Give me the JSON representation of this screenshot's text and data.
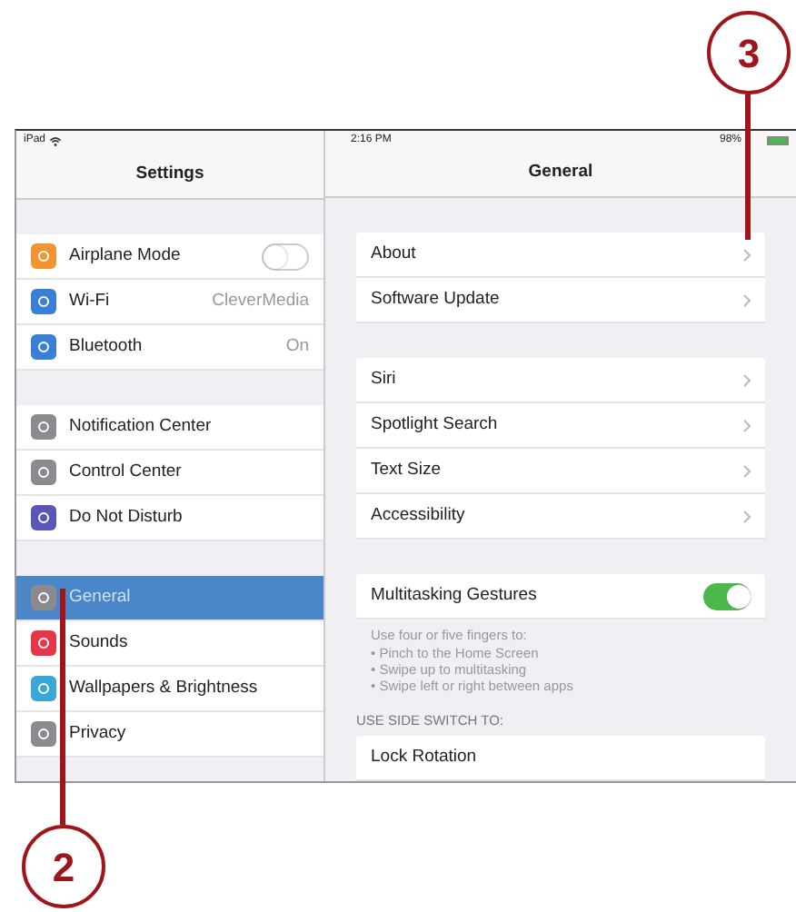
{
  "status_bar": {
    "device": "iPad",
    "time": "2:16 PM",
    "battery": "98%"
  },
  "sidebar": {
    "title": "Settings",
    "groups": [
      {
        "items": [
          {
            "label": "Airplane Mode",
            "color": "#f0952f",
            "kind": "toggle",
            "on": false,
            "selected": false
          },
          {
            "label": "Wi-Fi",
            "color": "#3a7fd6",
            "kind": "value",
            "value": "CleverMedia",
            "selected": false
          },
          {
            "label": "Bluetooth",
            "color": "#3a7fd6",
            "kind": "value",
            "value": "On",
            "selected": false
          }
        ]
      },
      {
        "items": [
          {
            "label": "Notification Center",
            "color": "#8a8a8f",
            "kind": "plain",
            "selected": false
          },
          {
            "label": "Control Center",
            "color": "#8a8a8f",
            "kind": "plain",
            "selected": false
          },
          {
            "label": "Do Not Disturb",
            "color": "#5a55b8",
            "kind": "plain",
            "selected": false
          }
        ]
      },
      {
        "items": [
          {
            "label": "General",
            "color": "#8a8a8f",
            "kind": "plain",
            "selected": true
          },
          {
            "label": "Sounds",
            "color": "#e8354a",
            "kind": "plain",
            "selected": false
          },
          {
            "label": "Wallpapers & Brightness",
            "color": "#3aa7d9",
            "kind": "plain",
            "selected": false
          },
          {
            "label": "Privacy",
            "color": "#8a8a8f",
            "kind": "plain",
            "selected": false
          }
        ]
      }
    ]
  },
  "detail": {
    "title": "General",
    "groups": [
      {
        "rows": [
          {
            "label": "About",
            "kind": "link"
          },
          {
            "label": "Software Update",
            "kind": "link"
          }
        ]
      },
      {
        "rows": [
          {
            "label": "Siri",
            "kind": "link"
          },
          {
            "label": "Spotlight Search",
            "kind": "link"
          },
          {
            "label": "Text Size",
            "kind": "link"
          },
          {
            "label": "Accessibility",
            "kind": "link"
          }
        ]
      },
      {
        "rows": [
          {
            "label": "Multitasking Gestures",
            "kind": "toggle",
            "on": true
          }
        ],
        "footer_lines": [
          "Use four or five fingers to:",
          "• Pinch to the Home Screen",
          "• Swipe up to multitasking",
          "• Swipe left or right between apps"
        ]
      },
      {
        "header": "USE SIDE SWITCH TO:",
        "rows": [
          {
            "label": "Lock Rotation",
            "kind": "plain"
          }
        ]
      }
    ]
  },
  "callouts": [
    {
      "number": "3"
    },
    {
      "number": "2"
    }
  ]
}
